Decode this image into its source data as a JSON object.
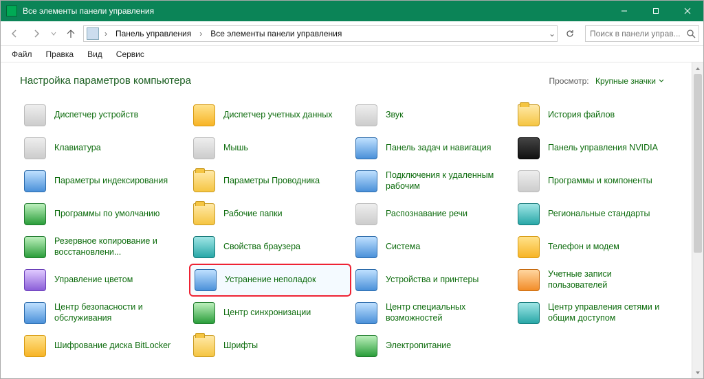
{
  "window": {
    "title": "Все элементы панели управления"
  },
  "address": {
    "seg1": "Панель управления",
    "seg2": "Все элементы панели управления"
  },
  "search": {
    "placeholder": "Поиск в панели управ..."
  },
  "menu": {
    "file": "Файл",
    "edit": "Правка",
    "view": "Вид",
    "tools": "Сервис"
  },
  "header": {
    "title": "Настройка параметров компьютера",
    "view_label": "Просмотр:",
    "view_mode": "Крупные значки"
  },
  "items": {
    "r0c0": "Диспетчер устройств",
    "r0c1": "Диспетчер учетных данных",
    "r0c2": "Звук",
    "r0c3": "История файлов",
    "r1c0": "Клавиатура",
    "r1c1": "Мышь",
    "r1c2": "Панель задач и навигация",
    "r1c3": "Панель управления NVIDIA",
    "r2c0": "Параметры индексирования",
    "r2c1": "Параметры Проводника",
    "r2c2": "Подключения к удаленным рабочим",
    "r2c3": "Программы и компоненты",
    "r3c0": "Программы по умолчанию",
    "r3c1": "Рабочие папки",
    "r3c2": "Распознавание речи",
    "r3c3": "Региональные стандарты",
    "r4c0": "Резервное копирование и восстановлени...",
    "r4c1": "Свойства браузера",
    "r4c2": "Система",
    "r4c3": "Телефон и модем",
    "r5c0": "Управление цветом",
    "r5c1": "Устранение неполадок",
    "r5c2": "Устройства и принтеры",
    "r5c3": "Учетные записи пользователей",
    "r6c0": "Центр безопасности и обслуживания",
    "r6c1": "Центр синхронизации",
    "r6c2": "Центр специальных возможностей",
    "r6c3": "Центр управления сетями и общим доступом",
    "r7c0": "Шифрование диска BitLocker",
    "r7c1": "Шрифты",
    "r7c2": "Электропитание"
  }
}
